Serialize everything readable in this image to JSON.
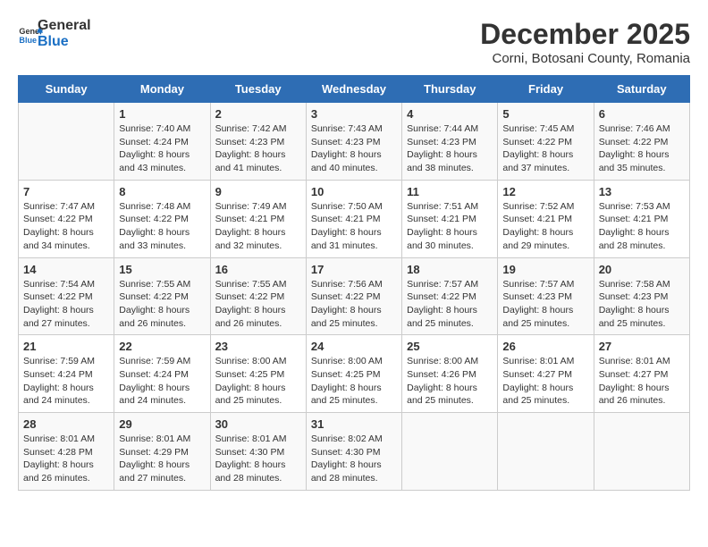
{
  "logo": {
    "general": "General",
    "blue": "Blue"
  },
  "title": "December 2025",
  "subtitle": "Corni, Botosani County, Romania",
  "days_of_week": [
    "Sunday",
    "Monday",
    "Tuesday",
    "Wednesday",
    "Thursday",
    "Friday",
    "Saturday"
  ],
  "weeks": [
    [
      {
        "day": "",
        "sunrise": "",
        "sunset": "",
        "daylight": ""
      },
      {
        "day": "1",
        "sunrise": "Sunrise: 7:40 AM",
        "sunset": "Sunset: 4:24 PM",
        "daylight": "Daylight: 8 hours and 43 minutes."
      },
      {
        "day": "2",
        "sunrise": "Sunrise: 7:42 AM",
        "sunset": "Sunset: 4:23 PM",
        "daylight": "Daylight: 8 hours and 41 minutes."
      },
      {
        "day": "3",
        "sunrise": "Sunrise: 7:43 AM",
        "sunset": "Sunset: 4:23 PM",
        "daylight": "Daylight: 8 hours and 40 minutes."
      },
      {
        "day": "4",
        "sunrise": "Sunrise: 7:44 AM",
        "sunset": "Sunset: 4:23 PM",
        "daylight": "Daylight: 8 hours and 38 minutes."
      },
      {
        "day": "5",
        "sunrise": "Sunrise: 7:45 AM",
        "sunset": "Sunset: 4:22 PM",
        "daylight": "Daylight: 8 hours and 37 minutes."
      },
      {
        "day": "6",
        "sunrise": "Sunrise: 7:46 AM",
        "sunset": "Sunset: 4:22 PM",
        "daylight": "Daylight: 8 hours and 35 minutes."
      }
    ],
    [
      {
        "day": "7",
        "sunrise": "Sunrise: 7:47 AM",
        "sunset": "Sunset: 4:22 PM",
        "daylight": "Daylight: 8 hours and 34 minutes."
      },
      {
        "day": "8",
        "sunrise": "Sunrise: 7:48 AM",
        "sunset": "Sunset: 4:22 PM",
        "daylight": "Daylight: 8 hours and 33 minutes."
      },
      {
        "day": "9",
        "sunrise": "Sunrise: 7:49 AM",
        "sunset": "Sunset: 4:21 PM",
        "daylight": "Daylight: 8 hours and 32 minutes."
      },
      {
        "day": "10",
        "sunrise": "Sunrise: 7:50 AM",
        "sunset": "Sunset: 4:21 PM",
        "daylight": "Daylight: 8 hours and 31 minutes."
      },
      {
        "day": "11",
        "sunrise": "Sunrise: 7:51 AM",
        "sunset": "Sunset: 4:21 PM",
        "daylight": "Daylight: 8 hours and 30 minutes."
      },
      {
        "day": "12",
        "sunrise": "Sunrise: 7:52 AM",
        "sunset": "Sunset: 4:21 PM",
        "daylight": "Daylight: 8 hours and 29 minutes."
      },
      {
        "day": "13",
        "sunrise": "Sunrise: 7:53 AM",
        "sunset": "Sunset: 4:21 PM",
        "daylight": "Daylight: 8 hours and 28 minutes."
      }
    ],
    [
      {
        "day": "14",
        "sunrise": "Sunrise: 7:54 AM",
        "sunset": "Sunset: 4:22 PM",
        "daylight": "Daylight: 8 hours and 27 minutes."
      },
      {
        "day": "15",
        "sunrise": "Sunrise: 7:55 AM",
        "sunset": "Sunset: 4:22 PM",
        "daylight": "Daylight: 8 hours and 26 minutes."
      },
      {
        "day": "16",
        "sunrise": "Sunrise: 7:55 AM",
        "sunset": "Sunset: 4:22 PM",
        "daylight": "Daylight: 8 hours and 26 minutes."
      },
      {
        "day": "17",
        "sunrise": "Sunrise: 7:56 AM",
        "sunset": "Sunset: 4:22 PM",
        "daylight": "Daylight: 8 hours and 25 minutes."
      },
      {
        "day": "18",
        "sunrise": "Sunrise: 7:57 AM",
        "sunset": "Sunset: 4:22 PM",
        "daylight": "Daylight: 8 hours and 25 minutes."
      },
      {
        "day": "19",
        "sunrise": "Sunrise: 7:57 AM",
        "sunset": "Sunset: 4:23 PM",
        "daylight": "Daylight: 8 hours and 25 minutes."
      },
      {
        "day": "20",
        "sunrise": "Sunrise: 7:58 AM",
        "sunset": "Sunset: 4:23 PM",
        "daylight": "Daylight: 8 hours and 25 minutes."
      }
    ],
    [
      {
        "day": "21",
        "sunrise": "Sunrise: 7:59 AM",
        "sunset": "Sunset: 4:24 PM",
        "daylight": "Daylight: 8 hours and 24 minutes."
      },
      {
        "day": "22",
        "sunrise": "Sunrise: 7:59 AM",
        "sunset": "Sunset: 4:24 PM",
        "daylight": "Daylight: 8 hours and 24 minutes."
      },
      {
        "day": "23",
        "sunrise": "Sunrise: 8:00 AM",
        "sunset": "Sunset: 4:25 PM",
        "daylight": "Daylight: 8 hours and 25 minutes."
      },
      {
        "day": "24",
        "sunrise": "Sunrise: 8:00 AM",
        "sunset": "Sunset: 4:25 PM",
        "daylight": "Daylight: 8 hours and 25 minutes."
      },
      {
        "day": "25",
        "sunrise": "Sunrise: 8:00 AM",
        "sunset": "Sunset: 4:26 PM",
        "daylight": "Daylight: 8 hours and 25 minutes."
      },
      {
        "day": "26",
        "sunrise": "Sunrise: 8:01 AM",
        "sunset": "Sunset: 4:27 PM",
        "daylight": "Daylight: 8 hours and 25 minutes."
      },
      {
        "day": "27",
        "sunrise": "Sunrise: 8:01 AM",
        "sunset": "Sunset: 4:27 PM",
        "daylight": "Daylight: 8 hours and 26 minutes."
      }
    ],
    [
      {
        "day": "28",
        "sunrise": "Sunrise: 8:01 AM",
        "sunset": "Sunset: 4:28 PM",
        "daylight": "Daylight: 8 hours and 26 minutes."
      },
      {
        "day": "29",
        "sunrise": "Sunrise: 8:01 AM",
        "sunset": "Sunset: 4:29 PM",
        "daylight": "Daylight: 8 hours and 27 minutes."
      },
      {
        "day": "30",
        "sunrise": "Sunrise: 8:01 AM",
        "sunset": "Sunset: 4:30 PM",
        "daylight": "Daylight: 8 hours and 28 minutes."
      },
      {
        "day": "31",
        "sunrise": "Sunrise: 8:02 AM",
        "sunset": "Sunset: 4:30 PM",
        "daylight": "Daylight: 8 hours and 28 minutes."
      },
      {
        "day": "",
        "sunrise": "",
        "sunset": "",
        "daylight": ""
      },
      {
        "day": "",
        "sunrise": "",
        "sunset": "",
        "daylight": ""
      },
      {
        "day": "",
        "sunrise": "",
        "sunset": "",
        "daylight": ""
      }
    ]
  ]
}
